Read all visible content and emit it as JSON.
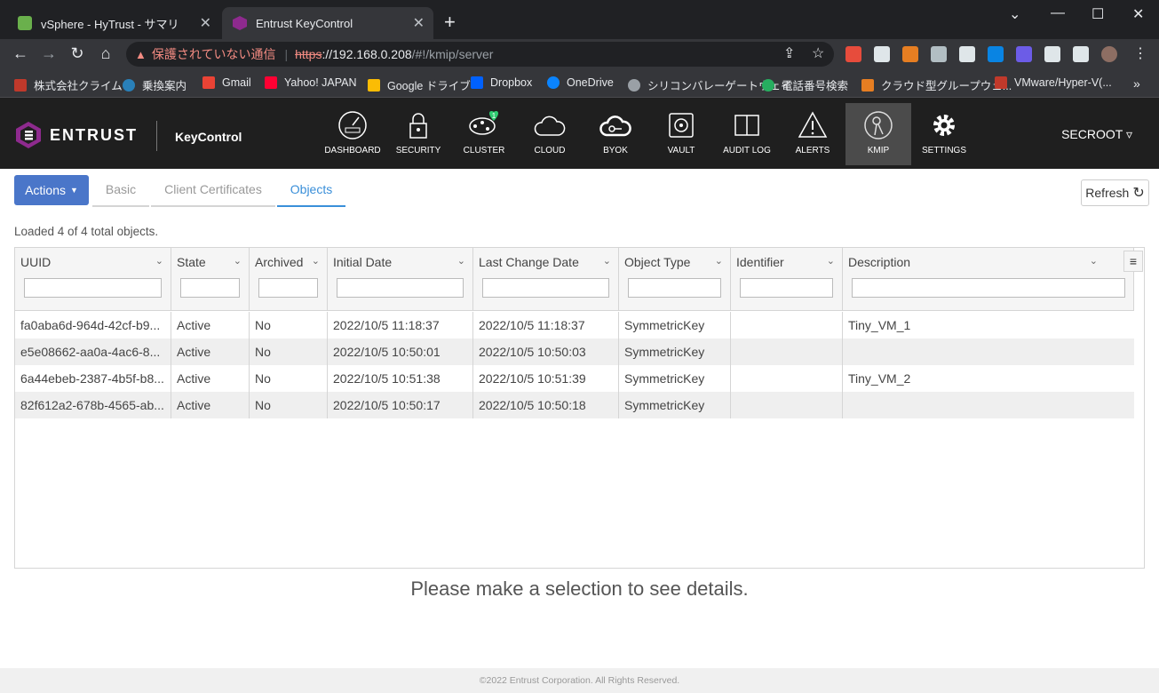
{
  "browser": {
    "tabs": [
      {
        "title": "vSphere - HyTrust - サマリ",
        "color": "#6ab04c"
      },
      {
        "title": "Entrust KeyControl",
        "color": "#8e2a8e"
      }
    ],
    "address": {
      "warning": "保護されていない通信",
      "scheme": "https",
      "host": "://192.168.0.208",
      "path": "/#!/kmip/server"
    },
    "bookmarks": [
      {
        "label": "株式会社クライム",
        "color": "#c0392b"
      },
      {
        "label": "乗換案内",
        "color": "#2980b9"
      },
      {
        "label": "Gmail",
        "color": "#ea4335"
      },
      {
        "label": "Yahoo! JAPAN",
        "color": "#ff0033"
      },
      {
        "label": "Google ドライブ",
        "color": "#fbbc04"
      },
      {
        "label": "Dropbox",
        "color": "#0061ff"
      },
      {
        "label": "OneDrive",
        "color": "#0a84ff"
      },
      {
        "label": "シリコンバレーゲートウェイ",
        "color": "#9aa0a6"
      },
      {
        "label": "電話番号検索",
        "color": "#27ae60"
      },
      {
        "label": "クラウド型グループウェ...",
        "color": "#e67e22"
      },
      {
        "label": "VMware/Hyper-V(...",
        "color": "#c0392b"
      }
    ]
  },
  "app": {
    "brand": "ENTRUST",
    "product": "KeyControl",
    "nav": [
      {
        "label": "DASHBOARD",
        "icon": "gauge-icon"
      },
      {
        "label": "SECURITY",
        "icon": "lock-icon"
      },
      {
        "label": "CLUSTER",
        "icon": "cluster-icon",
        "badge": "1"
      },
      {
        "label": "CLOUD",
        "icon": "cloud-icon"
      },
      {
        "label": "BYOK",
        "icon": "cloud-key-icon"
      },
      {
        "label": "VAULT",
        "icon": "vault-icon"
      },
      {
        "label": "AUDIT LOG",
        "icon": "book-icon"
      },
      {
        "label": "ALERTS",
        "icon": "warning-icon"
      },
      {
        "label": "KMIP",
        "icon": "kmip-icon",
        "active": true
      },
      {
        "label": "SETTINGS",
        "icon": "gear-icon"
      }
    ],
    "user": "SECROOT"
  },
  "page": {
    "actions_label": "Actions",
    "tabs": [
      "Basic",
      "Client Certificates",
      "Objects"
    ],
    "active_tab": "Objects",
    "refresh_label": "Refresh",
    "loaded_text": "Loaded 4 of 4 total objects.",
    "columns": [
      "UUID",
      "State",
      "Archived",
      "Initial Date",
      "Last Change Date",
      "Object Type",
      "Identifier",
      "Description"
    ],
    "rows": [
      [
        "fa0aba6d-964d-42cf-b9...",
        "Active",
        "No",
        "2022/10/5 11:18:37",
        "2022/10/5 11:18:37",
        "SymmetricKey",
        "",
        "Tiny_VM_1"
      ],
      [
        "e5e08662-aa0a-4ac6-8...",
        "Active",
        "No",
        "2022/10/5 10:50:01",
        "2022/10/5 10:50:03",
        "SymmetricKey",
        "",
        ""
      ],
      [
        "6a44ebeb-2387-4b5f-b8...",
        "Active",
        "No",
        "2022/10/5 10:51:38",
        "2022/10/5 10:51:39",
        "SymmetricKey",
        "",
        "Tiny_VM_2"
      ],
      [
        "82f612a2-678b-4565-ab...",
        "Active",
        "No",
        "2022/10/5 10:50:17",
        "2022/10/5 10:50:18",
        "SymmetricKey",
        "",
        ""
      ]
    ],
    "selection_message": "Please make a selection to see details.",
    "footer": "©2022 Entrust Corporation. All Rights Reserved."
  }
}
